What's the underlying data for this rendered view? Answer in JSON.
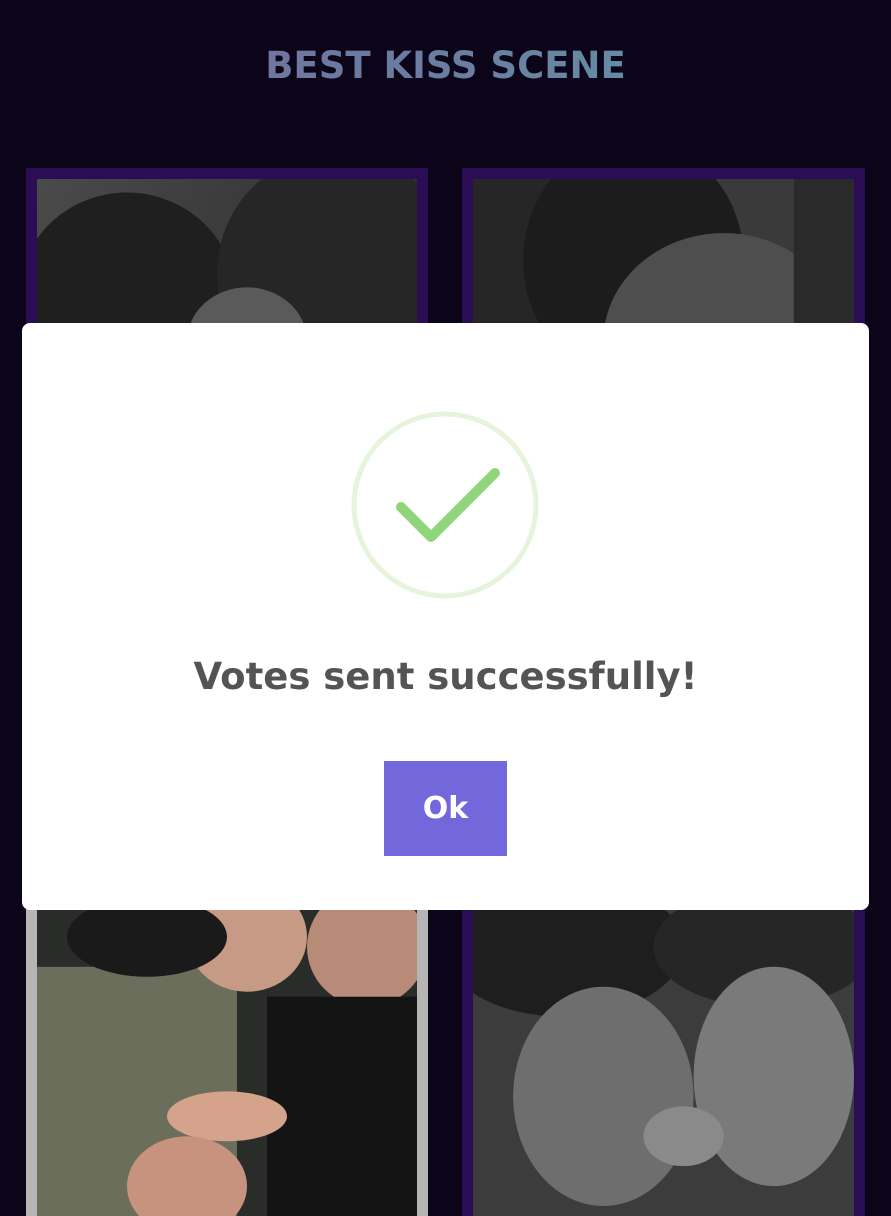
{
  "page": {
    "title": "BEST KISS SCENE"
  },
  "gallery": {
    "items": [
      {
        "name": "nominee-1",
        "image": "kiss-scene-photo-grayscale"
      },
      {
        "name": "nominee-2",
        "image": "kiss-scene-photo-grayscale"
      },
      {
        "name": "nominee-3",
        "image": "kiss-scene-photo-color"
      },
      {
        "name": "nominee-4",
        "image": "kiss-scene-photo-grayscale"
      }
    ]
  },
  "modal": {
    "icon": "checkmark-icon",
    "message": "Votes sent successfully!",
    "ok_label": "Ok"
  },
  "colors": {
    "background": "#0c0418",
    "card_border": "#2a0d55",
    "button": "#7367dc",
    "check_green": "#8fd67b",
    "check_ring": "#e6f4dd",
    "message_text": "#545454"
  }
}
